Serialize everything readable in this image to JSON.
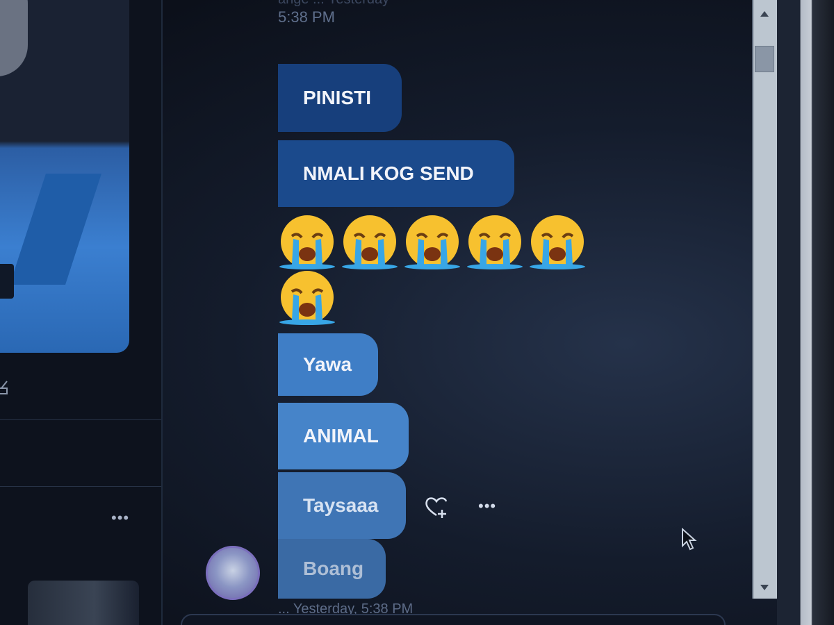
{
  "chat": {
    "header_faded": "ange ... Yesterday",
    "header_time": "5:38 PM",
    "messages": [
      {
        "text": "PINISTI"
      },
      {
        "text": "NMALI KOG SEND"
      },
      {
        "text": "Yawa"
      },
      {
        "text": "ANIMAL"
      },
      {
        "text": "Taysaaa"
      },
      {
        "text": "Boang"
      }
    ],
    "emoji_message": {
      "icon": "loudly-crying-face-emoji",
      "count": 6
    },
    "footer_meta": "... Yesterday, 5:38 PM",
    "message_actions": {
      "react_icon": "heart-plus-icon",
      "more": "•••"
    }
  },
  "left_panel": {
    "more": "•••"
  },
  "colors": {
    "bubble_dark": "#173f7c",
    "bubble_light": "#4684c9",
    "background": "#141c2c"
  }
}
